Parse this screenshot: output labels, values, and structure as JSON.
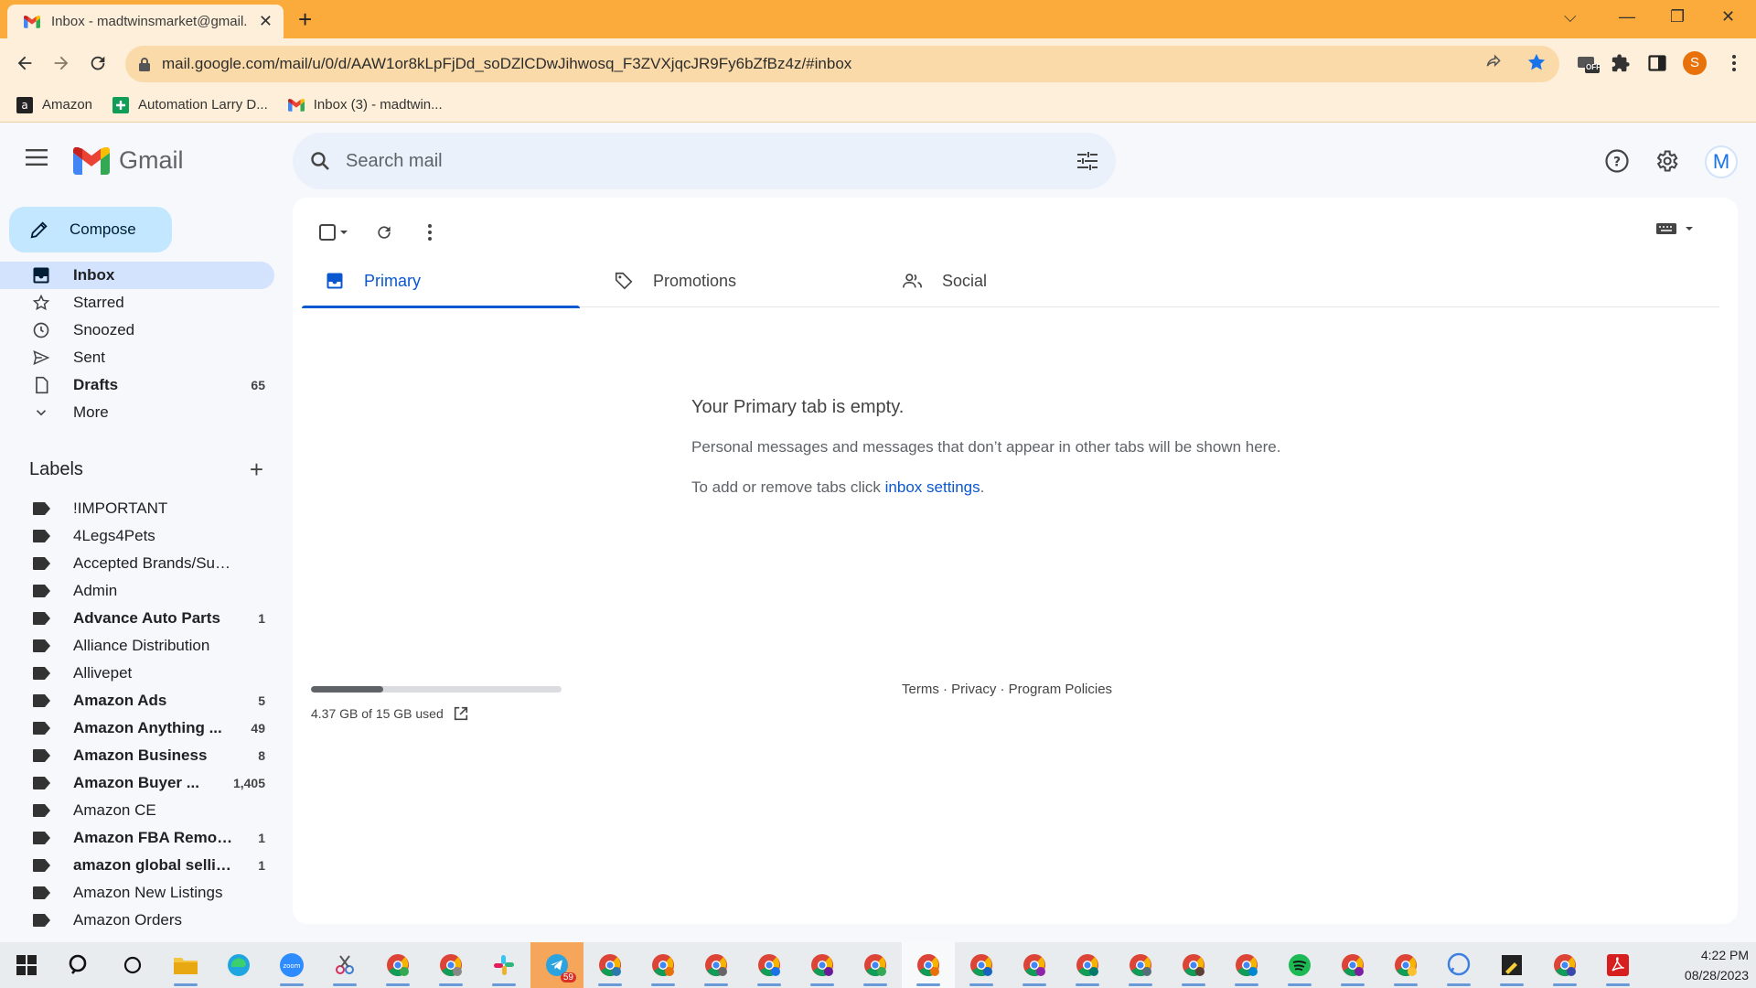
{
  "browser": {
    "tab_title": "Inbox - madtwinsmarket@gmail.",
    "url": "mail.google.com/mail/u/0/d/AAW1or8kLpFjDd_soDZlCDwJihwosq_F3ZVXjqcJR9Fy6bZfBz4z/#inbox",
    "profile_initial": "S",
    "ext_badge": "OFF",
    "bookmarks": [
      {
        "label": "Amazon"
      },
      {
        "label": "Automation Larry D..."
      },
      {
        "label": "Inbox (3) - madtwin..."
      }
    ]
  },
  "gmail": {
    "brand": "Gmail",
    "search_placeholder": "Search mail",
    "avatar_initial": "M",
    "compose_label": "Compose",
    "nav": [
      {
        "label": "Inbox",
        "count": "",
        "icon": "inbox-icon"
      },
      {
        "label": "Starred",
        "count": "",
        "icon": "star-icon"
      },
      {
        "label": "Snoozed",
        "count": "",
        "icon": "clock-icon"
      },
      {
        "label": "Sent",
        "count": "",
        "icon": "send-icon"
      },
      {
        "label": "Drafts",
        "count": "65",
        "icon": "draft-icon"
      },
      {
        "label": "More",
        "count": "",
        "icon": "chevron-down-icon"
      }
    ],
    "labels_heading": "Labels",
    "labels": [
      {
        "label": "!IMPORTANT",
        "count": ""
      },
      {
        "label": "4Legs4Pets",
        "count": ""
      },
      {
        "label": "Accepted Brands/Suppli...",
        "count": ""
      },
      {
        "label": "Admin",
        "count": ""
      },
      {
        "label": "Advance Auto Parts",
        "count": "1"
      },
      {
        "label": "Alliance Distribution",
        "count": ""
      },
      {
        "label": "Allivepet",
        "count": ""
      },
      {
        "label": "Amazon Ads",
        "count": "5"
      },
      {
        "label": "Amazon Anything ...",
        "count": "49"
      },
      {
        "label": "Amazon Business",
        "count": "8"
      },
      {
        "label": "Amazon Buyer ...",
        "count": "1,405"
      },
      {
        "label": "Amazon CE",
        "count": ""
      },
      {
        "label": "Amazon FBA Remov...",
        "count": "1"
      },
      {
        "label": "amazon global selling",
        "count": "1"
      },
      {
        "label": "Amazon New Listings",
        "count": ""
      },
      {
        "label": "Amazon Orders",
        "count": ""
      }
    ],
    "category_tabs": [
      {
        "label": "Primary"
      },
      {
        "label": "Promotions"
      },
      {
        "label": "Social"
      }
    ],
    "empty": {
      "heading": "Your Primary tab is empty.",
      "line1": "Personal messages and messages that don’t appear in other tabs will be shown here.",
      "line2_prefix": "To add or remove tabs click ",
      "line2_link": "inbox settings",
      "line2_suffix": "."
    },
    "storage": {
      "text": "4.37 GB of 15 GB used",
      "fraction_used": 0.29
    },
    "footer": "Terms · Privacy · Program Policies"
  },
  "taskbar": {
    "telegram_badge": "59",
    "time": "4:22 PM",
    "date": "08/28/2023"
  },
  "colors": {
    "browser_frame": "#fbab3c",
    "gmail_accent": "#0b57d0",
    "compose_bg": "#c2e7ff",
    "nav_active_bg": "#d3e3fd"
  }
}
